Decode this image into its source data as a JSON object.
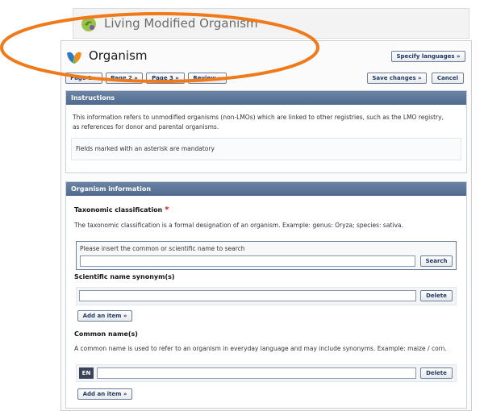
{
  "background_header": {
    "title": "Living Modified Organism"
  },
  "page": {
    "title": "Organism",
    "specify_languages": "Specify languages »",
    "tabs": [
      "Page 1 »",
      "Page 2 »",
      "Page 3 »",
      "Review »"
    ],
    "save_changes": "Save changes »",
    "cancel": "Cancel"
  },
  "instructions": {
    "header": "Instructions",
    "text": "This information refers to unmodified organisms (non-LMOs) which are linked to other registries, such as the LMO registry, as references for donor and parental organisms.",
    "mandatory_note": "Fields marked with an asterisk are mandatory"
  },
  "organism_info": {
    "header": "Organism information",
    "taxonomic": {
      "label": "Taxonomic classification",
      "required_mark": "*",
      "description": "The taxonomic classification is a formal designation of an organism. Example: genus: Oryza; species: sativa.",
      "search_hint": "Please insert the common or scientific name to search",
      "search_value": "",
      "search_button": "Search"
    },
    "synonym": {
      "label": "Scientific name synonym(s)",
      "value": "",
      "delete_button": "Delete",
      "add_item": "Add an item »"
    },
    "common_names": {
      "label": "Common name(s)",
      "description": "A common name is used to refer to an organism in everyday language and may include synonyms. Example: maize / corn.",
      "language_badge": "EN",
      "value": "",
      "delete_button": "Delete",
      "add_item": "Add an item »"
    }
  },
  "colors": {
    "section_header": "#506a8e",
    "button_text": "#1f3a66",
    "annotation": "#f07a1a",
    "required": "#d11b1b"
  }
}
